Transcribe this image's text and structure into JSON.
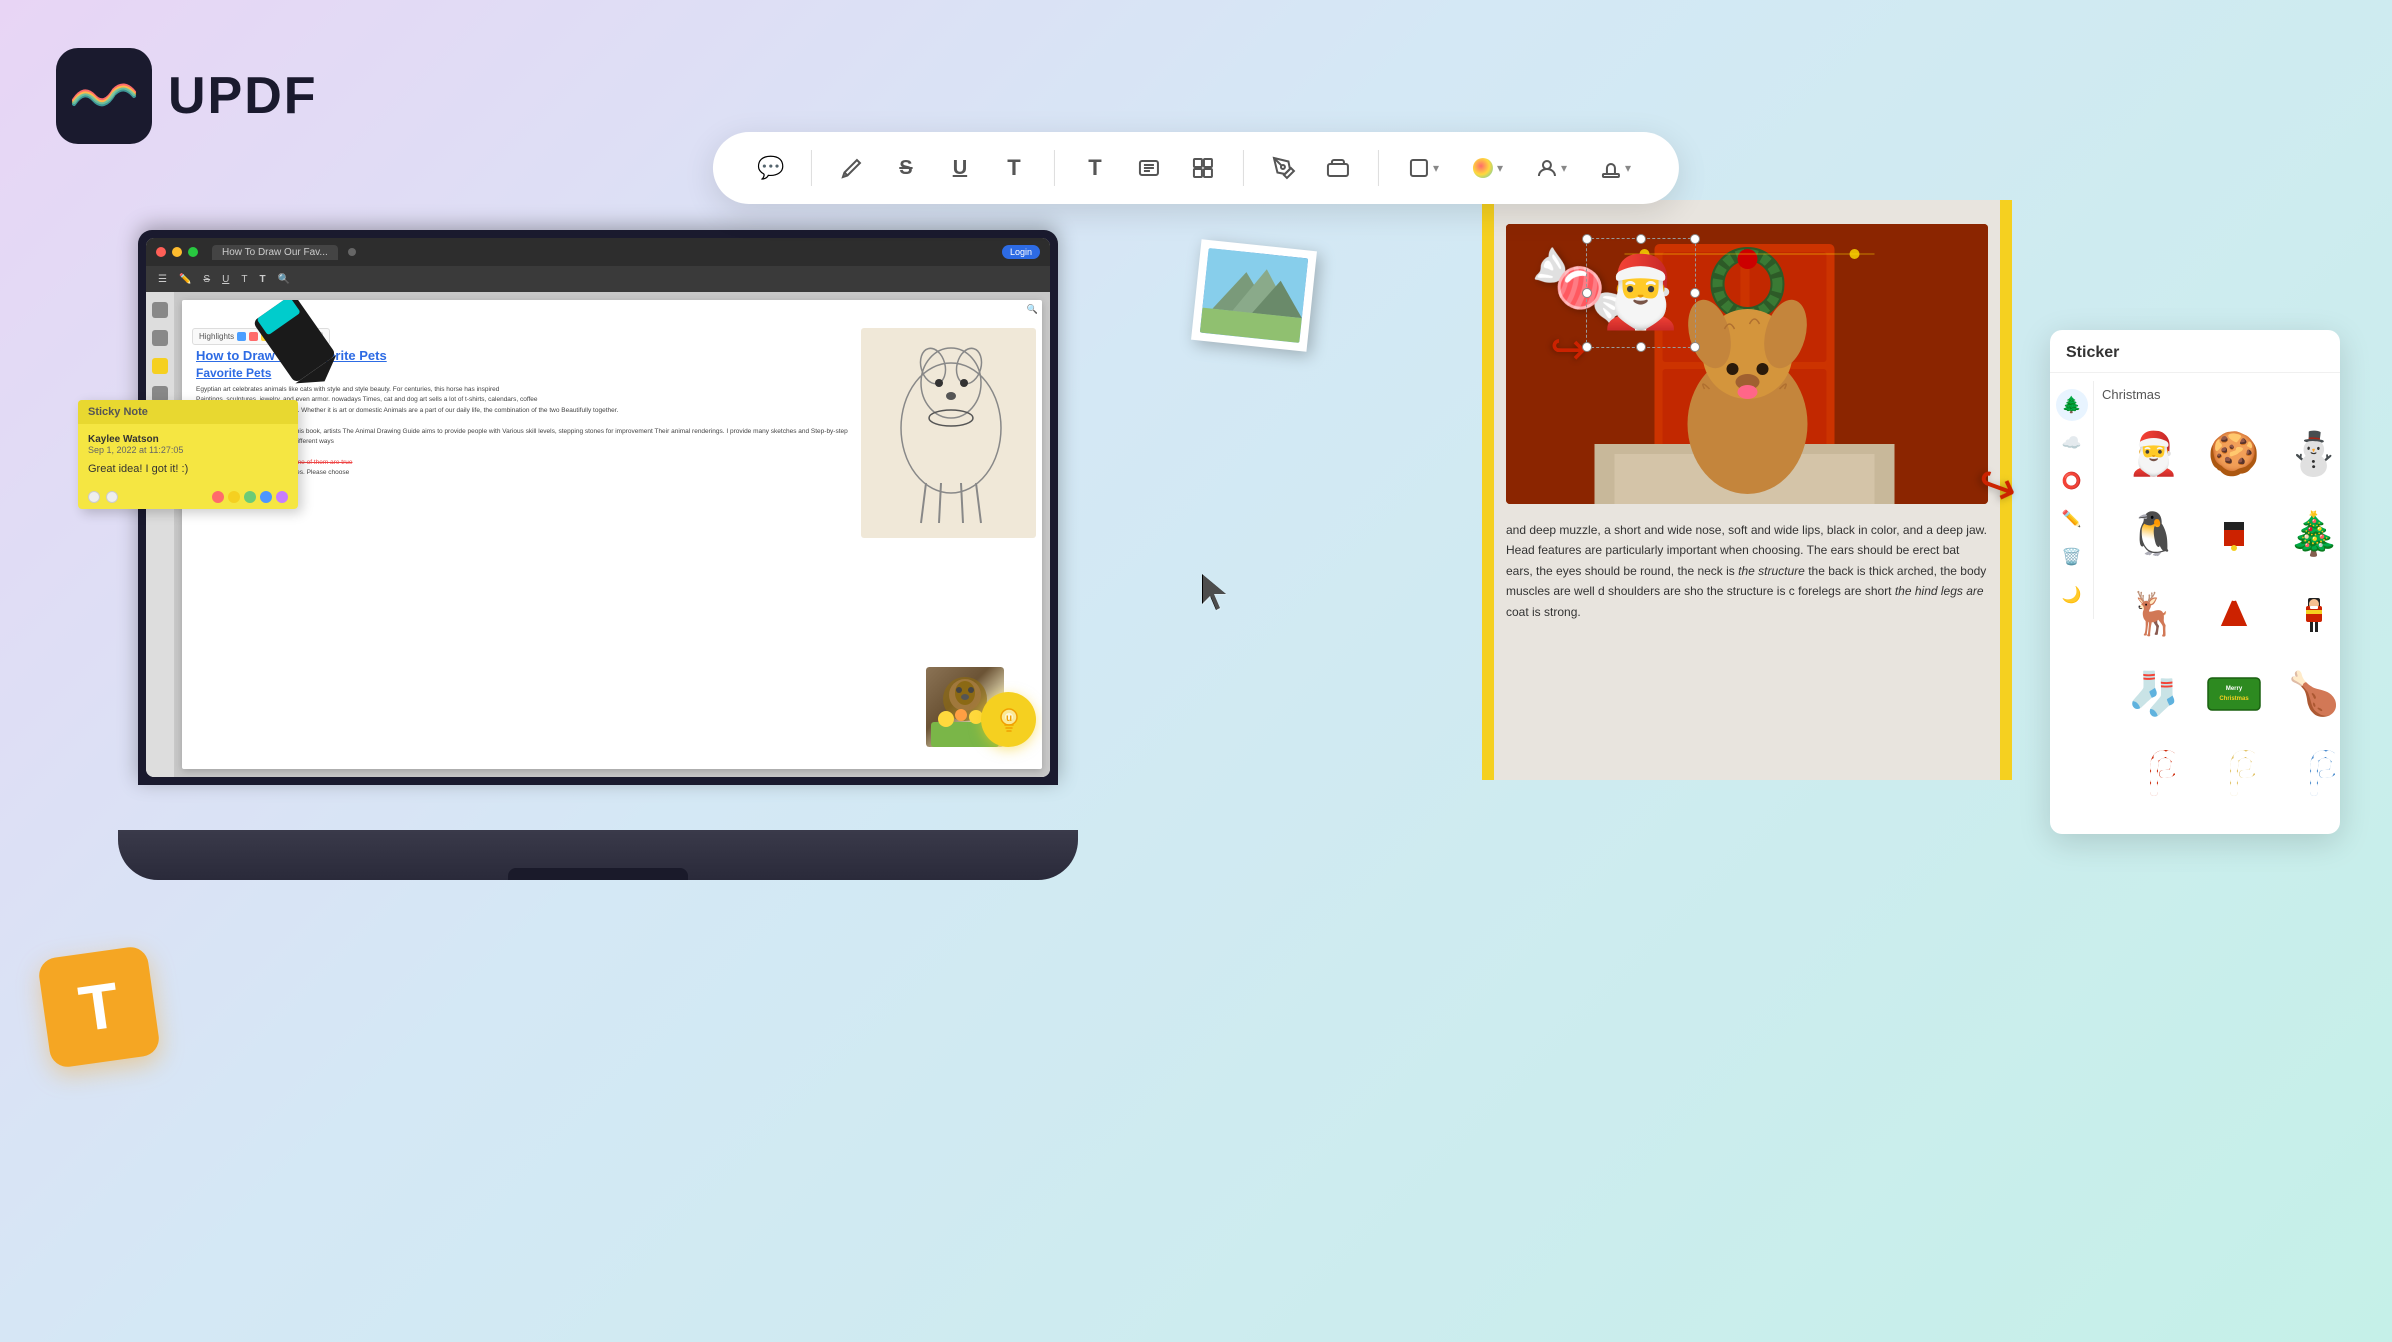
{
  "app": {
    "name": "UPDF",
    "logo_text": "UPDF"
  },
  "toolbar": {
    "tools": [
      {
        "name": "comment",
        "icon": "💬"
      },
      {
        "name": "pencil",
        "icon": "✏️"
      },
      {
        "name": "strikethrough",
        "icon": "S"
      },
      {
        "name": "underline",
        "icon": "U"
      },
      {
        "name": "text",
        "icon": "T"
      },
      {
        "name": "text-box",
        "icon": "T"
      },
      {
        "name": "text-frame",
        "icon": "⊞"
      },
      {
        "name": "list",
        "icon": "☰"
      },
      {
        "name": "pen",
        "icon": "🖊"
      },
      {
        "name": "eraser",
        "icon": "⬜"
      },
      {
        "name": "shape",
        "icon": "⬜"
      },
      {
        "name": "color",
        "icon": "🔴"
      },
      {
        "name": "user",
        "icon": "👤"
      },
      {
        "name": "stamp",
        "icon": "📋"
      }
    ]
  },
  "pdf_document": {
    "title": "How to Draw Our Favorite Pets",
    "tab_label": "How To Draw Our Fav...",
    "highlight_label": "Highlights",
    "body_paragraphs": [
      "Egyptian art celebrates animals like cats with style and style beauty. For centuries, this horse has inspired",
      "Paintings, sculptures, jewelry, and even armor. nowadays Times, cat and dog art sells a lot of t-shirts, calendars, coffee",
      "Cups, store brands and other items. Whether it is art or domestic Animals are a part of our daily life, the combination of the two Beautifully together.",
      "This combination is the subject of this book, artists The Animal Drawing Guide aims to provide people with Various skill levels, stepping stones for improvement Their animal renderings. I provide many sketches and Step-by-step examples to help readers see the different ways",
      "Build the anatomy of an animal. some of them are true basic and other more advanced ones. Please choose"
    ]
  },
  "sticky_note": {
    "header": "Sticky Note",
    "author": "Kaylee Watson",
    "date": "Sep 1, 2022 at 11:27:05",
    "text": "Great idea! I got it! :)",
    "colors": [
      "#ff6b6b",
      "#ffd93d",
      "#6bcb77",
      "#4d96ff",
      "#c77dff"
    ]
  },
  "sticker_panel": {
    "title": "Sticker",
    "category": "Christmas",
    "stickers": [
      {
        "name": "santa-claus",
        "emoji": "🎅"
      },
      {
        "name": "gingerbread",
        "emoji": "🍪"
      },
      {
        "name": "snowman",
        "emoji": "⛄"
      },
      {
        "name": "penguin",
        "emoji": "🐧"
      },
      {
        "name": "santa-suit",
        "emoji": "🎅"
      },
      {
        "name": "christmas-tree",
        "emoji": "🎄"
      },
      {
        "name": "reindeer",
        "emoji": "🦌"
      },
      {
        "name": "santa-hat",
        "emoji": "🎅"
      },
      {
        "name": "nutcracker",
        "emoji": "🪆"
      },
      {
        "name": "stocking",
        "emoji": "🧦"
      },
      {
        "name": "merry-christmas",
        "emoji": "🎄"
      },
      {
        "name": "turkey",
        "emoji": "🦃"
      },
      {
        "name": "candy-cane-1",
        "emoji": "🍬"
      },
      {
        "name": "candy-cane-2",
        "emoji": "🍭"
      },
      {
        "name": "candy-cane-3",
        "emoji": "🎀"
      }
    ]
  },
  "main_pdf_text": {
    "paragraph": "and deep muzzle, a short and wide nose, soft and wide lips, black in color, and a deep jaw. Head features are particularly important when choosing. The ears should be erect bat ears, the eyes should be round, the neck is the structure is the back is thick arched, the body muscles are well c shoulders are sho the structure is c forelegs are short the hind legs are s coat is strong.",
    "detected_text_1": "the structure",
    "detected_text_2": "the hind legs are"
  },
  "colors": {
    "background_gradient_start": "#e8d5f5",
    "background_gradient_end": "#c5f0e8",
    "accent_yellow": "#f5d020",
    "accent_blue": "#2d6be4",
    "toolbar_bg": "#ffffff",
    "sticker_panel_bg": "#ffffff",
    "laptop_body": "#1a1a2e"
  }
}
